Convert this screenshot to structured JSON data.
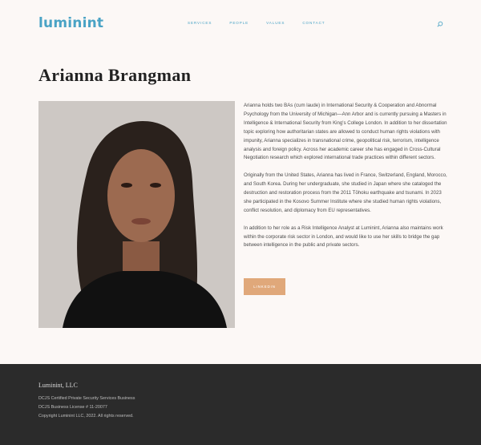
{
  "header": {
    "logo": "luminint",
    "nav": [
      "SERVICES",
      "PEOPLE",
      "VALUES",
      "CONTACT"
    ]
  },
  "profile": {
    "name": "Arianna Brangman",
    "bio": [
      "Arianna holds two BAs (cum laude) in International Security & Cooperation and Abnormal Psychology from the University of Michigan—Ann Arbor and is currently pursuing a Masters in Intelligence & International Security from King's College London. In addition to her dissertation topic exploring how authoritarian states are allowed to conduct human rights violations with impunity, Arianna specializes in transnational crime, geopolitical risk, terrorism, intelligence analysis and foreign policy. Across her academic career she has engaged in Cross-Cultural Negotiation research which explored international trade practices within different sectors.",
      "Originally from the United States, Arianna has lived in France, Switzerland, England, Morocco, and South Korea. During her undergraduate, she studied in Japan where she cataloged the destruction and restoration process from the 2011 Tōhoku earthquake and tsunami. In 2023 she participated in the Kosovo Summer Institute where she studied human rights violations, conflict resolution, and diplomacy from EU representatives.",
      "In addition to her role as a Risk Intelligence Analyst at Luminint, Arianna also maintains work within the corporate risk sector in London, and would like to use her skills to bridge the gap between intelligence in the public and private sectors."
    ],
    "button": "LINKEDIN"
  },
  "footer": {
    "brand": "Luminint, LLC",
    "lines": [
      "DCJS Certified Private Security Services Business",
      "DCJS Business License # 11-20077",
      "Copyright Luminint LLC, 2022.  All rights reserved."
    ]
  },
  "colors": {
    "accent": "#4aa3c5",
    "button": "#e0a87a",
    "background": "#fcf8f6",
    "footer": "#2b2b2b"
  }
}
